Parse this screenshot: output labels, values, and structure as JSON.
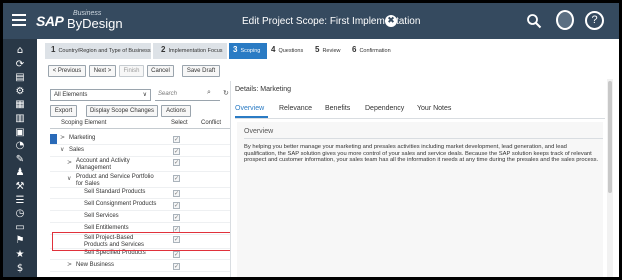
{
  "shell": {
    "logo_sap": "SAP",
    "logo_business": "Business",
    "logo_bydesign": "ByDesign",
    "title": "Edit Project Scope: First Implementation",
    "close_glyph": "✖",
    "help_glyph": "?"
  },
  "sidebar_icons": [
    "⌂",
    "⟳",
    "▤",
    "⚙",
    "▦",
    "▥",
    "▣",
    "◔",
    "✎",
    "♟",
    "⚒",
    "☰",
    "◷",
    "▭",
    "⚑",
    "★",
    "$"
  ],
  "steps": [
    {
      "num": "1",
      "label": "Country/Region and Type of Business"
    },
    {
      "num": "2",
      "label": "Implementation Focus"
    },
    {
      "num": "3",
      "label": "Scoping"
    },
    {
      "num": "4",
      "label": "Questions"
    },
    {
      "num": "5",
      "label": "Review"
    },
    {
      "num": "6",
      "label": "Confirmation"
    }
  ],
  "toolbar": {
    "previous": "< Previous",
    "next": "Next >",
    "finish": "Finish",
    "cancel": "Cancel",
    "save_draft": "Save Draft"
  },
  "left_panel": {
    "filter_value": "All Elements",
    "search_placeholder": "Search",
    "export": "Export",
    "display_scope_changes": "Display Scope Changes",
    "actions": "Actions",
    "col_element": "Scoping Element",
    "col_select": "Select",
    "col_conflict": "Conflict",
    "rows": [
      {
        "label": "Marketing",
        "chevron": ">",
        "checked": "✓"
      },
      {
        "label": "Sales",
        "chevron": "∨",
        "checked": "✓"
      },
      {
        "label": "Account and Activity",
        "label2": "Management",
        "chevron": ">",
        "checked": "✓"
      },
      {
        "label": "Product and Service Portfolio",
        "label2": "for Sales",
        "chevron": "∨",
        "checked": "✓"
      },
      {
        "label": "Sell Standard Products",
        "chevron": "",
        "checked": "✓"
      },
      {
        "label": "Sell Consignment Products",
        "chevron": "",
        "checked": "✓"
      },
      {
        "label": "Sell Services",
        "chevron": "",
        "checked": "✓"
      },
      {
        "label": "Sell Entitlements",
        "chevron": "",
        "checked": "✓"
      },
      {
        "label": "Sell Project-Based",
        "label2": "Products and Services",
        "chevron": "",
        "checked": "✓"
      },
      {
        "label": "Sell Specified Products",
        "chevron": "",
        "checked": "✓"
      },
      {
        "label": "New Business",
        "chevron": ">",
        "checked": "✓"
      }
    ]
  },
  "detail": {
    "title": "Details: Marketing",
    "tabs": [
      "Overview",
      "Relevance",
      "Benefits",
      "Dependency",
      "Your Notes"
    ],
    "section_title": "Overview",
    "body": "By helping you better manage your marketing and presales activities including market development, lead generation, and lead qualification, the SAP solution gives you more control of your sales and service deals. Because the SAP solution keeps track of relevant prospect and customer information, your sales team has all the information it needs at any time during the presales and the sales process."
  },
  "colors": {
    "shell": "#354a5f",
    "sidebar": "#293847",
    "accent": "#2a7bc4",
    "highlight": "#e0313b"
  }
}
